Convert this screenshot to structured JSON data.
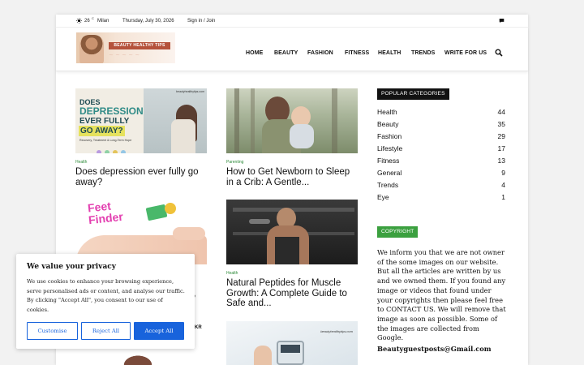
{
  "topbar": {
    "temperature": "26",
    "degree": "C",
    "city": "Milan",
    "date": "Thursday, July 30, 2026",
    "sign_in": "Sign in / Join"
  },
  "logo": {
    "text": "BEAUTY HEALTHY TIPS"
  },
  "nav": {
    "items": [
      "HOME",
      "BEAUTY",
      "FASHION",
      "FITNESS",
      "HEALTH",
      "TRENDS",
      "WRITE FOR US"
    ]
  },
  "articles": [
    {
      "category": "Health",
      "title": "Does depression ever fully go away?",
      "image_text": {
        "l1": "DOES",
        "l2": "DEPRESSION",
        "l3": "EVER FULLY",
        "l4": "GO AWAY?",
        "sub": "Recovery, Treatment & Long-Term Hope",
        "site": "beautyhealthytips.com"
      }
    },
    {
      "category": "Parenting",
      "title": "How to Get Newborn to Sleep in a Crib: A Gentle..."
    },
    {
      "category": "",
      "title": "",
      "image_text": {
        "l1": "Feet",
        "l2": "Finder"
      }
    },
    {
      "category": "Health",
      "title": "Natural Peptides for Muscle Growth: A Complete Guide to Safe and..."
    },
    {
      "category": "",
      "title": "",
      "image_text": {
        "site": "beautyhealthytips.com"
      }
    }
  ],
  "sidebar": {
    "popular_heading": "POPULAR CATEGORIES",
    "categories": [
      {
        "name": "Health",
        "count": "44"
      },
      {
        "name": "Beauty",
        "count": "35"
      },
      {
        "name": "Fashion",
        "count": "29"
      },
      {
        "name": "Lifestyle",
        "count": "17"
      },
      {
        "name": "Fitness",
        "count": "13"
      },
      {
        "name": "General",
        "count": "9"
      },
      {
        "name": "Trends",
        "count": "4"
      },
      {
        "name": "Eye",
        "count": "1"
      }
    ],
    "copyright_heading": "COPYRIGHT",
    "copyright_text": "We inform you that we are not owner of the some images on our website. But all the articles are written by us and we owned them. If you found any image or videos that found under your copyrights then please feel free to CONTACT US. We will remove that image as soon as possible. Some of the images are collected from Google.",
    "email": "Beautyguestposts@Gmail.com"
  },
  "cookie": {
    "heading": "We value your privacy",
    "body": "We use cookies to enhance your browsing experience, serve personalised ads or content, and analyse our traffic. By clicking \"Accept All\", you consent to our use of cookies.",
    "customise": "Customise",
    "reject": "Reject All",
    "accept": "Accept All",
    "peek_title_fragment": "e,",
    "peek_badge": "KR"
  },
  "colors": {
    "category_green": "#2e8b3a",
    "cookie_blue": "#1863dc",
    "copyright_green": "#3ba03f",
    "logo_brown": "#b5523b"
  }
}
